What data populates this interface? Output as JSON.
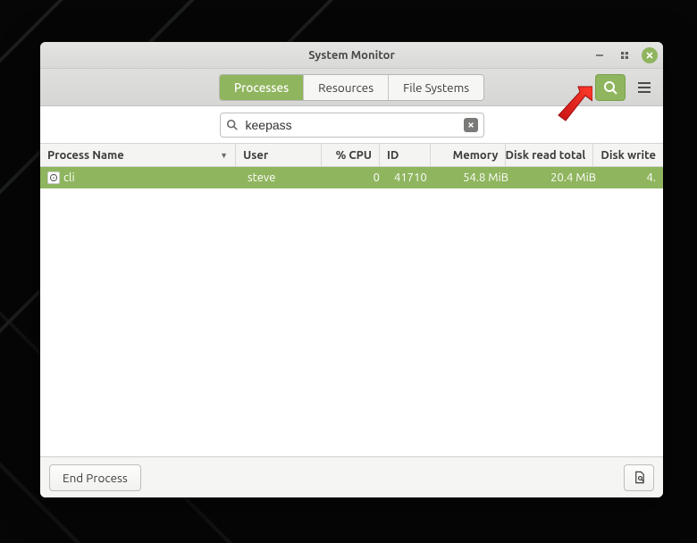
{
  "window": {
    "title": "System Monitor"
  },
  "tabs": {
    "processes": "Processes",
    "resources": "Resources",
    "filesystems": "File Systems"
  },
  "search": {
    "value": "keepass"
  },
  "columns": {
    "name": "Process Name",
    "user": "User",
    "cpu": "% CPU",
    "id": "ID",
    "memory": "Memory",
    "dread": "Disk read total",
    "dwrite": "Disk write"
  },
  "rows": [
    {
      "name": "cli",
      "user": "steve",
      "cpu": "0",
      "id": "41710",
      "memory": "54.8 MiB",
      "dread": "20.4 MiB",
      "dwrite": "4."
    }
  ],
  "footer": {
    "end_process": "End Process"
  },
  "colors": {
    "accent": "#8fb55e"
  }
}
